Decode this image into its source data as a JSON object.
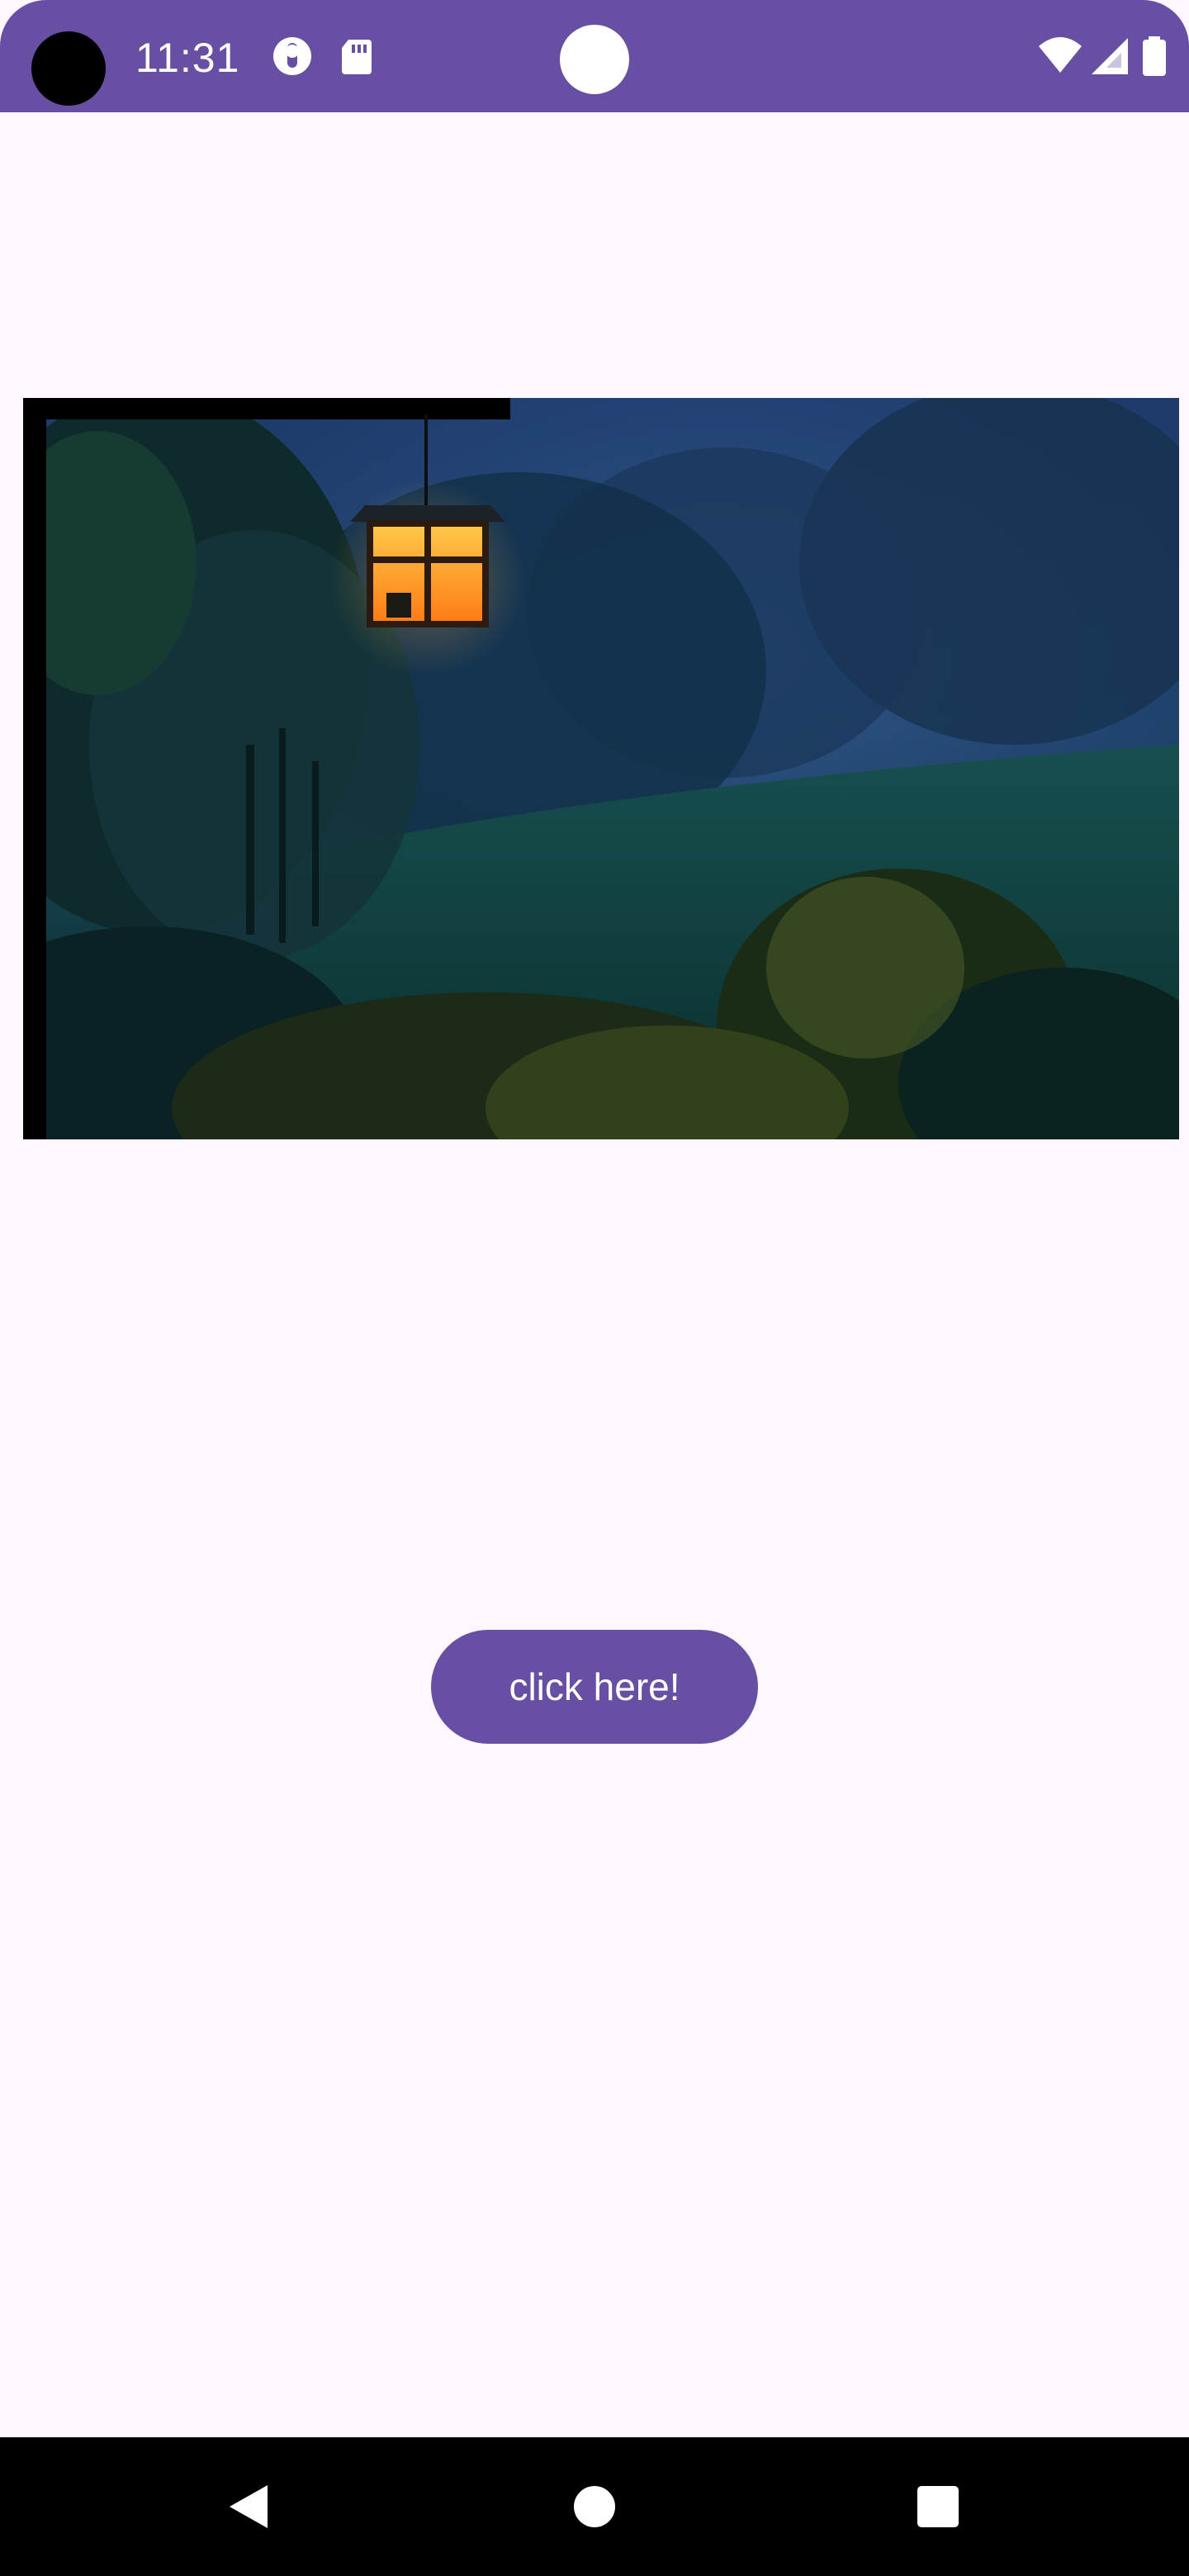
{
  "status_bar": {
    "time": "11:31",
    "background": "#6750a4",
    "icons": [
      "assistant-icon",
      "sd-card-icon",
      "wifi-icon",
      "cellular-signal-icon",
      "battery-icon"
    ]
  },
  "photo": {
    "description_icon": "lantern-night-garden-image"
  },
  "main": {
    "button_label": "click here!",
    "button_color": "#6750a4"
  },
  "nav_bar": {
    "icons": [
      "back-icon",
      "home-icon",
      "recents-icon"
    ]
  }
}
